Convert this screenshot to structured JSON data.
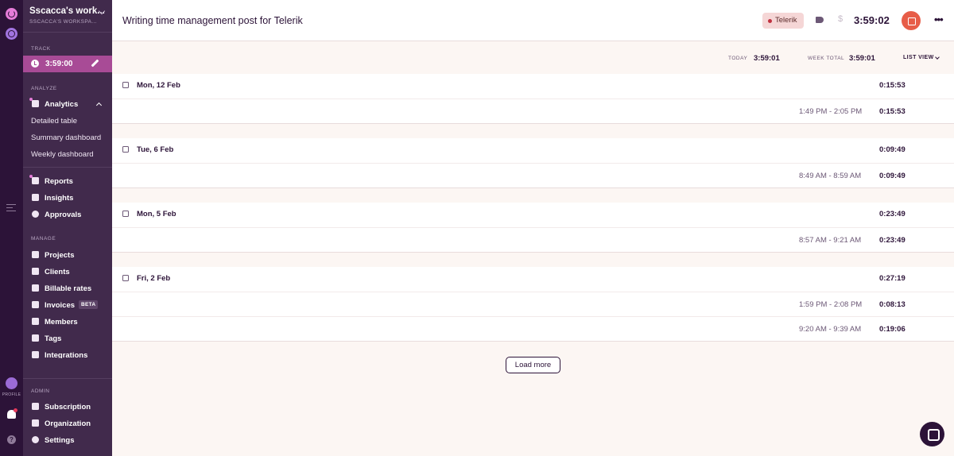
{
  "rail": {
    "profile_label": "PROFILE",
    "help_glyph": "?"
  },
  "sidebar": {
    "workspace_name": "Sscacca's work...",
    "workspace_sub": "SSCACCA'S WORKSPA...",
    "sections": {
      "track": "TRACK",
      "analyze": "ANALYZE",
      "manage": "MANAGE",
      "admin": "ADMIN"
    },
    "timer": "3:59:00",
    "analytics": "Analytics",
    "analytics_sub": [
      "Detailed table",
      "Summary dashboard",
      "Weekly dashboard"
    ],
    "analyze_items": [
      "Reports",
      "Insights",
      "Approvals"
    ],
    "manage_items": [
      "Projects",
      "Clients",
      "Billable rates",
      "Invoices",
      "Members",
      "Tags",
      "Integrations"
    ],
    "invoices_badge": "BETA",
    "admin_items": [
      "Subscription",
      "Organization",
      "Settings"
    ]
  },
  "header": {
    "title": "Writing time management post for Telerik",
    "project": "Telerik",
    "project_color": "#c0313f",
    "dollar": "$",
    "timer": "3:59:02",
    "more": "•••"
  },
  "summary": {
    "today_label": "TODAY",
    "today_value": "3:59:01",
    "week_label": "WEEK TOTAL",
    "week_value": "3:59:01",
    "view_label": "LIST VIEW"
  },
  "groups": [
    {
      "date": "Mon, 12 Feb",
      "total": "0:15:53",
      "entries": [
        {
          "range": "1:49 PM - 2:05 PM",
          "duration": "0:15:53"
        }
      ]
    },
    {
      "date": "Tue, 6 Feb",
      "total": "0:09:49",
      "entries": [
        {
          "range": "8:49 AM - 8:59 AM",
          "duration": "0:09:49"
        }
      ]
    },
    {
      "date": "Mon, 5 Feb",
      "total": "0:23:49",
      "entries": [
        {
          "range": "8:57 AM - 9:21 AM",
          "duration": "0:23:49"
        }
      ]
    },
    {
      "date": "Fri, 2 Feb",
      "total": "0:27:19",
      "entries": [
        {
          "range": "1:59 PM - 2:08 PM",
          "duration": "0:08:13"
        },
        {
          "range": "9:20 AM - 9:39 AM",
          "duration": "0:19:06"
        }
      ]
    }
  ],
  "load_more": "Load more",
  "colors": {
    "accent": "#a84b96",
    "stop": "#e75d48",
    "sidebar": "#412a4c",
    "rail": "#2c1338"
  }
}
